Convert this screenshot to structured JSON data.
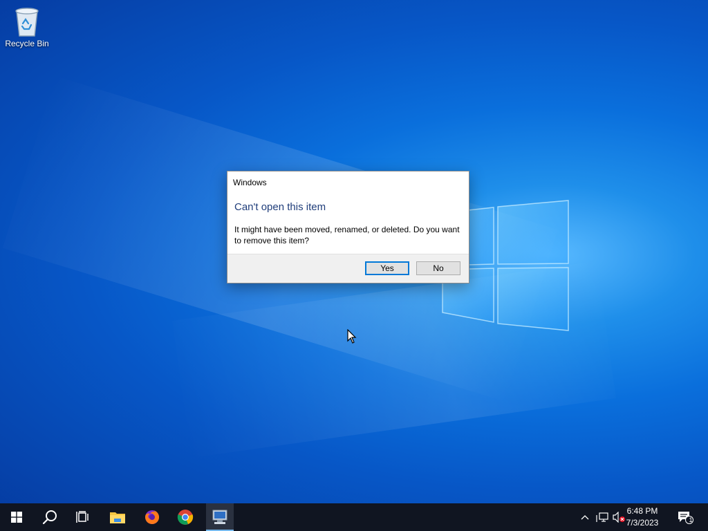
{
  "desktop": {
    "icons": [
      {
        "label": "Recycle Bin"
      }
    ]
  },
  "dialog": {
    "title": "Windows",
    "heading": "Can't open this item",
    "message": "It might have been moved, renamed, or deleted. Do you want to remove this item?",
    "yes_label": "Yes",
    "no_label": "No"
  },
  "taskbar": {
    "apps": [
      "start-icon",
      "search-icon",
      "task-view-icon",
      "file-explorer-icon",
      "firefox-icon",
      "chrome-icon",
      "remote-desktop-icon"
    ],
    "clock": {
      "time": "6:48 PM",
      "date": "7/3/2023"
    },
    "notification_count": "1"
  },
  "colors": {
    "accent": "#0078d7",
    "taskbar": "#101521",
    "heading": "#1f3d7a"
  }
}
